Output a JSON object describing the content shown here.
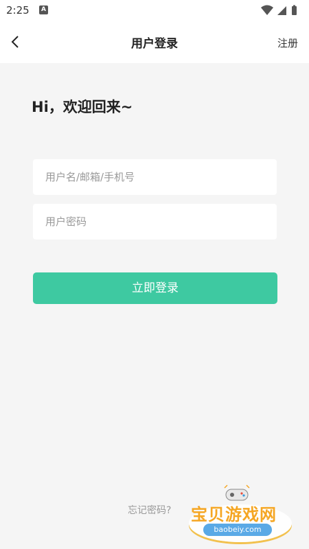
{
  "status_bar": {
    "time": "2:25",
    "notification_letter": "A"
  },
  "header": {
    "title": "用户登录",
    "register_label": "注册"
  },
  "greeting": "Hi，欢迎回来~",
  "form": {
    "username_placeholder": "用户名/邮箱/手机号",
    "password_placeholder": "用户密码",
    "username_value": "",
    "password_value": ""
  },
  "login_button": "立即登录",
  "forgot_password": "忘记密码?",
  "watermark": {
    "brand": "宝贝游戏网",
    "url": "baobeiy.com"
  },
  "colors": {
    "accent": "#3ec9a1",
    "background": "#f5f5f5"
  }
}
